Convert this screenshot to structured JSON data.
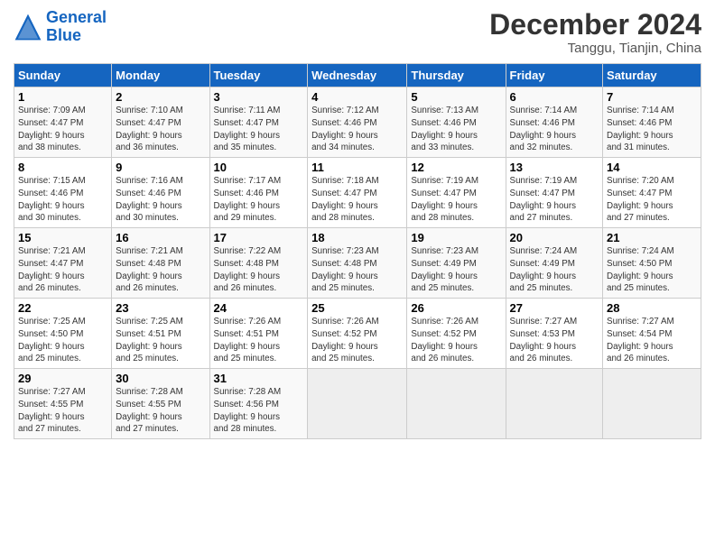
{
  "header": {
    "logo_line1": "General",
    "logo_line2": "Blue",
    "month_title": "December 2024",
    "location": "Tanggu, Tianjin, China"
  },
  "days_of_week": [
    "Sunday",
    "Monday",
    "Tuesday",
    "Wednesday",
    "Thursday",
    "Friday",
    "Saturday"
  ],
  "weeks": [
    [
      {
        "day": "1",
        "info": "Sunrise: 7:09 AM\nSunset: 4:47 PM\nDaylight: 9 hours\nand 38 minutes."
      },
      {
        "day": "2",
        "info": "Sunrise: 7:10 AM\nSunset: 4:47 PM\nDaylight: 9 hours\nand 36 minutes."
      },
      {
        "day": "3",
        "info": "Sunrise: 7:11 AM\nSunset: 4:47 PM\nDaylight: 9 hours\nand 35 minutes."
      },
      {
        "day": "4",
        "info": "Sunrise: 7:12 AM\nSunset: 4:46 PM\nDaylight: 9 hours\nand 34 minutes."
      },
      {
        "day": "5",
        "info": "Sunrise: 7:13 AM\nSunset: 4:46 PM\nDaylight: 9 hours\nand 33 minutes."
      },
      {
        "day": "6",
        "info": "Sunrise: 7:14 AM\nSunset: 4:46 PM\nDaylight: 9 hours\nand 32 minutes."
      },
      {
        "day": "7",
        "info": "Sunrise: 7:14 AM\nSunset: 4:46 PM\nDaylight: 9 hours\nand 31 minutes."
      }
    ],
    [
      {
        "day": "8",
        "info": "Sunrise: 7:15 AM\nSunset: 4:46 PM\nDaylight: 9 hours\nand 30 minutes."
      },
      {
        "day": "9",
        "info": "Sunrise: 7:16 AM\nSunset: 4:46 PM\nDaylight: 9 hours\nand 30 minutes."
      },
      {
        "day": "10",
        "info": "Sunrise: 7:17 AM\nSunset: 4:46 PM\nDaylight: 9 hours\nand 29 minutes."
      },
      {
        "day": "11",
        "info": "Sunrise: 7:18 AM\nSunset: 4:47 PM\nDaylight: 9 hours\nand 28 minutes."
      },
      {
        "day": "12",
        "info": "Sunrise: 7:19 AM\nSunset: 4:47 PM\nDaylight: 9 hours\nand 28 minutes."
      },
      {
        "day": "13",
        "info": "Sunrise: 7:19 AM\nSunset: 4:47 PM\nDaylight: 9 hours\nand 27 minutes."
      },
      {
        "day": "14",
        "info": "Sunrise: 7:20 AM\nSunset: 4:47 PM\nDaylight: 9 hours\nand 27 minutes."
      }
    ],
    [
      {
        "day": "15",
        "info": "Sunrise: 7:21 AM\nSunset: 4:47 PM\nDaylight: 9 hours\nand 26 minutes."
      },
      {
        "day": "16",
        "info": "Sunrise: 7:21 AM\nSunset: 4:48 PM\nDaylight: 9 hours\nand 26 minutes."
      },
      {
        "day": "17",
        "info": "Sunrise: 7:22 AM\nSunset: 4:48 PM\nDaylight: 9 hours\nand 26 minutes."
      },
      {
        "day": "18",
        "info": "Sunrise: 7:23 AM\nSunset: 4:48 PM\nDaylight: 9 hours\nand 25 minutes."
      },
      {
        "day": "19",
        "info": "Sunrise: 7:23 AM\nSunset: 4:49 PM\nDaylight: 9 hours\nand 25 minutes."
      },
      {
        "day": "20",
        "info": "Sunrise: 7:24 AM\nSunset: 4:49 PM\nDaylight: 9 hours\nand 25 minutes."
      },
      {
        "day": "21",
        "info": "Sunrise: 7:24 AM\nSunset: 4:50 PM\nDaylight: 9 hours\nand 25 minutes."
      }
    ],
    [
      {
        "day": "22",
        "info": "Sunrise: 7:25 AM\nSunset: 4:50 PM\nDaylight: 9 hours\nand 25 minutes."
      },
      {
        "day": "23",
        "info": "Sunrise: 7:25 AM\nSunset: 4:51 PM\nDaylight: 9 hours\nand 25 minutes."
      },
      {
        "day": "24",
        "info": "Sunrise: 7:26 AM\nSunset: 4:51 PM\nDaylight: 9 hours\nand 25 minutes."
      },
      {
        "day": "25",
        "info": "Sunrise: 7:26 AM\nSunset: 4:52 PM\nDaylight: 9 hours\nand 25 minutes."
      },
      {
        "day": "26",
        "info": "Sunrise: 7:26 AM\nSunset: 4:52 PM\nDaylight: 9 hours\nand 26 minutes."
      },
      {
        "day": "27",
        "info": "Sunrise: 7:27 AM\nSunset: 4:53 PM\nDaylight: 9 hours\nand 26 minutes."
      },
      {
        "day": "28",
        "info": "Sunrise: 7:27 AM\nSunset: 4:54 PM\nDaylight: 9 hours\nand 26 minutes."
      }
    ],
    [
      {
        "day": "29",
        "info": "Sunrise: 7:27 AM\nSunset: 4:55 PM\nDaylight: 9 hours\nand 27 minutes."
      },
      {
        "day": "30",
        "info": "Sunrise: 7:28 AM\nSunset: 4:55 PM\nDaylight: 9 hours\nand 27 minutes."
      },
      {
        "day": "31",
        "info": "Sunrise: 7:28 AM\nSunset: 4:56 PM\nDaylight: 9 hours\nand 28 minutes."
      },
      {
        "day": "",
        "info": ""
      },
      {
        "day": "",
        "info": ""
      },
      {
        "day": "",
        "info": ""
      },
      {
        "day": "",
        "info": ""
      }
    ]
  ]
}
